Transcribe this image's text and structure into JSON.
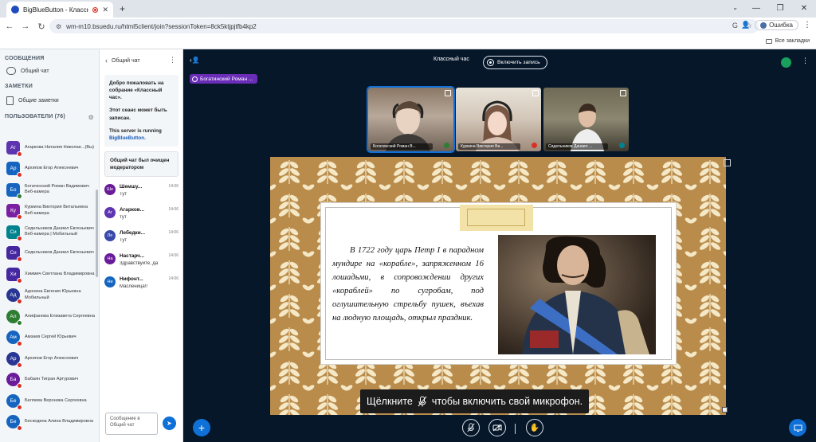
{
  "browser": {
    "tab_title": "BigBlueButton - Классный",
    "new_tab": "+",
    "url": "wm-m10.bsuedu.ru/html5client/join?sessionToken=8ck5ktjpjtfb4kp2",
    "profile_status": "Ошибка",
    "all_bookmarks": "Все закладки",
    "icons": [
      "back-icon",
      "forward-icon",
      "reload-icon",
      "translate-icon",
      "star-icon",
      "profile-icon",
      "kebab-icon"
    ]
  },
  "nav": {
    "messages_header": "СООБЩЕНИЯ",
    "public_chat": "Общий чат",
    "notes_header": "ЗАМЕТКИ",
    "shared_notes": "Общие заметки",
    "users_header": "ПОЛЬЗОВАТЕЛИ (76)",
    "users": [
      {
        "initials": "Аг",
        "name": "Агаркова Наталия Николае...(Вы)",
        "sub": "",
        "color": "#5e35b1",
        "mic": "#d93025",
        "shape": "square"
      },
      {
        "initials": "Ар",
        "name": "Архипов Егор Алексеевич",
        "sub": "",
        "color": "#1565c0",
        "mic": "#d93025",
        "shape": "square"
      },
      {
        "initials": "Бо",
        "name": "Богатинский Роман Вадимович",
        "sub": "Веб-камера",
        "color": "#1565c0",
        "mic": "#2e7d32",
        "shape": "square"
      },
      {
        "initials": "Ку",
        "name": "Куркина Виктория Витальевна",
        "sub": "Веб-камера",
        "color": "#7b1fa2",
        "mic": "#d93025",
        "shape": "square"
      },
      {
        "initials": "Си",
        "name": "Сидельников Даниил Евгеньевич",
        "sub": "Веб-камера | Мобильный",
        "color": "#00838f",
        "mic": "#d93025",
        "shape": "square"
      },
      {
        "initials": "Си",
        "name": "Сидельников Даниил Евгеньевич",
        "sub": "",
        "color": "#4527a0",
        "mic": "#d93025",
        "shape": "square"
      },
      {
        "initials": "Хи",
        "name": "Химмич Светлана Владимировна",
        "sub": "",
        "color": "#4527a0",
        "mic": "#d93025",
        "shape": "square"
      },
      {
        "initials": "Ад",
        "name": "Адонина Евгения Юрьевна",
        "sub": "Мобильный",
        "color": "#283593",
        "mic": "#d93025",
        "shape": "round"
      },
      {
        "initials": "Ал",
        "name": "Алифанова Елизавета Сергеевна",
        "sub": "",
        "color": "#2e7d32",
        "mic": "#2e7d32",
        "shape": "round"
      },
      {
        "initials": "Ам",
        "name": "Амзаев Сергей Юрьевич",
        "sub": "",
        "color": "#1565c0",
        "mic": "#d93025",
        "shape": "round"
      },
      {
        "initials": "Ар",
        "name": "Архипов Егор Алексеевич",
        "sub": "",
        "color": "#283593",
        "mic": "#d93025",
        "shape": "round"
      },
      {
        "initials": "Ба",
        "name": "Бабаян Тигран Артурович",
        "sub": "",
        "color": "#6a1b9a",
        "mic": "#d93025",
        "shape": "round"
      },
      {
        "initials": "Бе",
        "name": "Беляева Вероника Сергеевна",
        "sub": "",
        "color": "#1565c0",
        "mic": "#d93025",
        "shape": "round"
      },
      {
        "initials": "Бе",
        "name": "Бескедина Алина Владимировна",
        "sub": "",
        "color": "#1565c0",
        "mic": "#d93025",
        "shape": "round"
      }
    ]
  },
  "chat": {
    "back_label": "Общий чат",
    "welcome_line1": "Добро пожаловать на собрание «Классный час».",
    "welcome_line2": "Этот сеанс может быть записан.",
    "welcome_line3": "This server is running",
    "welcome_link": "BigBlueButton.",
    "cleared": "Общий чат был очищен модератором",
    "messages": [
      {
        "initials": "Ше",
        "name": "Шемшу...",
        "time": "14:06",
        "text": "Тут",
        "color": "#6a1b9a"
      },
      {
        "initials": "Аг",
        "name": "Агарков...",
        "time": "14:06",
        "text": "тут",
        "color": "#5e35b1"
      },
      {
        "initials": "Ле",
        "name": "Лебедки...",
        "time": "14:06",
        "text": "Тут",
        "color": "#3949ab"
      },
      {
        "initials": "На",
        "name": "Настарч...",
        "time": "14:06",
        "text": "Здравствуйте, да",
        "color": "#6a1b9a"
      },
      {
        "initials": "Ни",
        "name": "Нифонт...",
        "time": "14:06",
        "text": "Масленица!!",
        "color": "#1565c0"
      }
    ],
    "input_placeholder": "Сообщение в Общий чат"
  },
  "stage": {
    "meeting_title": "Классный час",
    "record_label": "Включить запись",
    "talking": "Богатинский Роман ...",
    "videos": [
      {
        "name": "Богатинский Роман В...",
        "active": true,
        "indicator": "#2e7d32"
      },
      {
        "name": "Куркина Виктория Ви...",
        "active": false,
        "indicator": "#d93025"
      },
      {
        "name": "Сидельников Даниил ...",
        "active": false,
        "indicator": "#00838f"
      }
    ],
    "slide_text": "В 1722 году царь Петр I в парадном мундире на «корабле», запряженном 16 лошадьми, в сопровождении других «кораблей» по сугробам, под оглушительную стрельбу пушек, въехав на людную площадь, открыл праздник.",
    "mic_prompt_before": "Щёлкните",
    "mic_prompt_after": "чтобы включить свой микрофон.",
    "colors": {
      "accent": "#0f70d7",
      "stage_bg": "#06172a",
      "talker": "#6a2db8",
      "slide_bg": "#b88a4a"
    }
  }
}
